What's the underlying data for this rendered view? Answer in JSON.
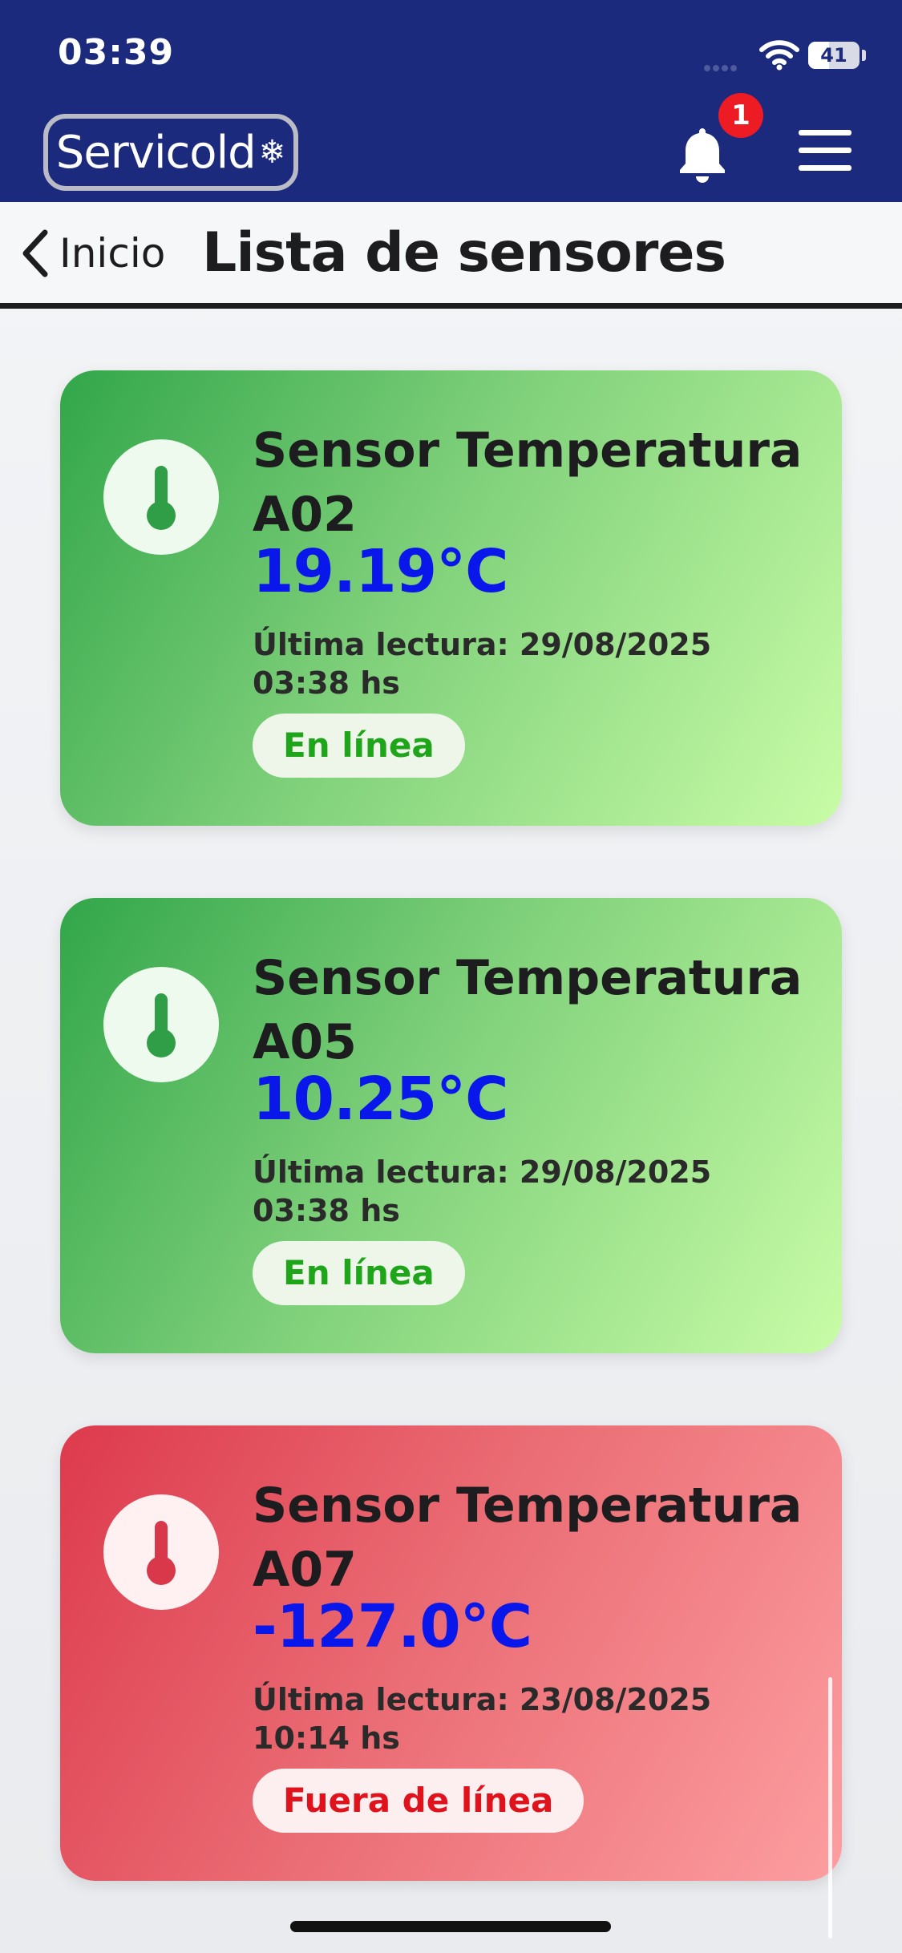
{
  "status_bar": {
    "time": "03:39",
    "battery": "41",
    "battery_level": 0.41
  },
  "header": {
    "logo_text": "Servicold",
    "logo_symbol": "❄",
    "notification_count": "1"
  },
  "nav": {
    "back_label": "Inicio",
    "title": "Lista de sensores"
  },
  "sensors": [
    {
      "name": "Sensor Temperatura A02",
      "temperature": "19.19°C",
      "last_reading": "Última lectura: 29/08/2025 03:38 hs",
      "status": "En línea",
      "state": "online"
    },
    {
      "name": "Sensor Temperatura A05",
      "temperature": "10.25°C",
      "last_reading": "Última lectura: 29/08/2025 03:38 hs",
      "status": "En línea",
      "state": "online"
    },
    {
      "name": "Sensor Temperatura A07",
      "temperature": "-127.0°C",
      "last_reading": "Última lectura: 23/08/2025 10:14 hs",
      "status": "Fuera de línea",
      "state": "offline"
    }
  ],
  "colors": {
    "header_bg": "#1b2a7c",
    "online_card": "#32a64a",
    "offline_card": "#dd3a4d",
    "temperature_text": "#0a17ea",
    "online_text": "#1ea51a",
    "offline_text": "#e0121c",
    "badge": "#ec1b24"
  },
  "icons": {
    "thermometer": "thermometer-icon",
    "bell": "bell-icon",
    "menu": "menu-icon",
    "back": "chevron-left-icon",
    "wifi": "wifi-icon"
  }
}
